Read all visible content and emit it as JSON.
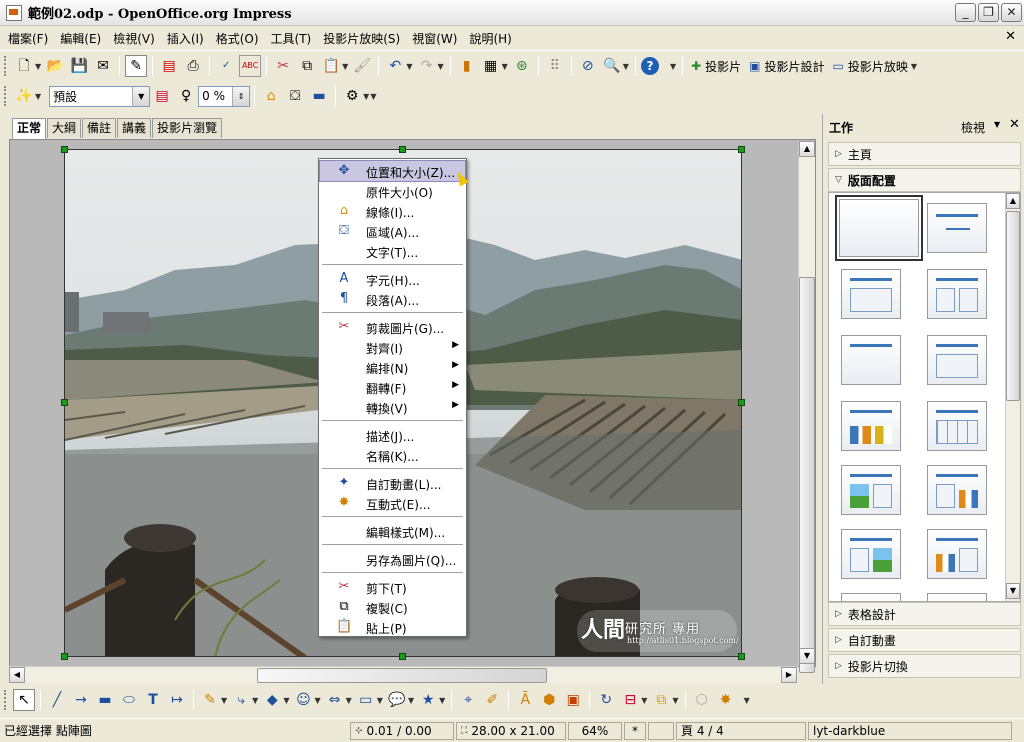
{
  "window": {
    "title": "範例02.odp - OpenOffice.org Impress"
  },
  "menu": [
    "檔案(F)",
    "編輯(E)",
    "檢視(V)",
    "插入(I)",
    "格式(O)",
    "工具(T)",
    "投影片放映(S)",
    "視窗(W)",
    "說明(H)"
  ],
  "toolbar": {
    "slide_label": "投影片",
    "slide_design_label": "投影片設計",
    "slideshow_label": "投影片放映"
  },
  "line_toolbar": {
    "line_style_value": "預設",
    "transparency_value": "0 %"
  },
  "view_tabs": [
    "正常",
    "大綱",
    "備註",
    "講義",
    "投影片瀏覽"
  ],
  "context_menu": {
    "items": [
      {
        "label": "位置和大小(Z)...",
        "icon": "position-size-icon",
        "highlighted": true
      },
      {
        "label": "原件大小(O)",
        "icon": ""
      },
      {
        "label": "線條(I)...",
        "icon": "line-icon"
      },
      {
        "label": "區域(A)...",
        "icon": "area-icon"
      },
      {
        "label": "文字(T)...",
        "icon": ""
      },
      {
        "label": "字元(H)...",
        "icon": "character-icon"
      },
      {
        "label": "段落(A)...",
        "icon": "paragraph-icon"
      },
      {
        "label": "剪裁圖片(G)...",
        "icon": "crop-icon"
      },
      {
        "label": "對齊(I)",
        "icon": "",
        "submenu": true
      },
      {
        "label": "編排(N)",
        "icon": "",
        "submenu": true
      },
      {
        "label": "翻轉(F)",
        "icon": "",
        "submenu": true
      },
      {
        "label": "轉換(V)",
        "icon": "",
        "submenu": true
      },
      {
        "label": "描述(J)...",
        "icon": ""
      },
      {
        "label": "名稱(K)...",
        "icon": ""
      },
      {
        "label": "自訂動畫(L)...",
        "icon": "custom-animation-icon"
      },
      {
        "label": "互動式(E)...",
        "icon": "interaction-icon"
      },
      {
        "label": "編輯樣式(M)...",
        "icon": ""
      },
      {
        "label": "另存為圖片(Q)...",
        "icon": ""
      },
      {
        "label": "剪下(T)",
        "icon": "cut-icon"
      },
      {
        "label": "複製(C)",
        "icon": "copy-icon"
      },
      {
        "label": "貼上(P)",
        "icon": "paste-icon"
      }
    ]
  },
  "watermark": {
    "main": "人間",
    "sub": "研究所 專用",
    "url": "http://atlis01.blogspot.com/"
  },
  "task_pane": {
    "title": "工作",
    "view_label": "檢視",
    "sections": {
      "master": "主頁",
      "layouts": "版面配置",
      "table_design": "表格設計",
      "custom_animation": "自訂動畫",
      "slide_transition": "投影片切換"
    }
  },
  "status": {
    "selection": "已經選擇 點陣圖",
    "position": "0.01 / 0.00",
    "size": "28.00 x 21.00",
    "zoom": "64%",
    "modified": "*",
    "page": "頁 4 / 4",
    "master": "lyt-darkblue"
  }
}
